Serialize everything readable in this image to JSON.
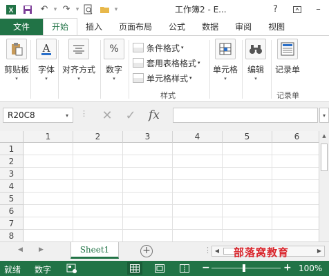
{
  "titlebar": {
    "title": "工作簿2 - E...",
    "help": "?",
    "quick_access": {
      "save_icon": "save-icon",
      "undo_icon": "undo-icon",
      "redo_icon": "redo-icon",
      "print_preview_icon": "print-preview-icon",
      "open_icon": "open-folder-icon"
    }
  },
  "tabs": [
    "文件",
    "开始",
    "插入",
    "页面布局",
    "公式",
    "数据",
    "审阅",
    "视图"
  ],
  "active_tab": "开始",
  "ribbon": {
    "clipboard": "剪贴板",
    "font": "字体",
    "alignment": "对齐方式",
    "number": "数字",
    "styles_items": [
      "条件格式",
      "套用表格格式",
      "单元格样式"
    ],
    "styles_group": "样式",
    "cells": "单元格",
    "editing": "编辑",
    "record": "记录单",
    "record_group": "记录单"
  },
  "formula_bar": {
    "name_box": "R20C8",
    "formula_value": "",
    "fx_label": "fx"
  },
  "grid": {
    "columns": [
      "1",
      "2",
      "3",
      "4",
      "5",
      "6"
    ],
    "rows": [
      "1",
      "2",
      "3",
      "4",
      "5",
      "6",
      "7",
      "8"
    ]
  },
  "sheets": {
    "active": "Sheet1",
    "add_label": "+"
  },
  "watermark": "部落窝教育",
  "status_bar": {
    "ready": "就绪",
    "num": "数字",
    "zoom": "100%",
    "accent": "#217346"
  }
}
